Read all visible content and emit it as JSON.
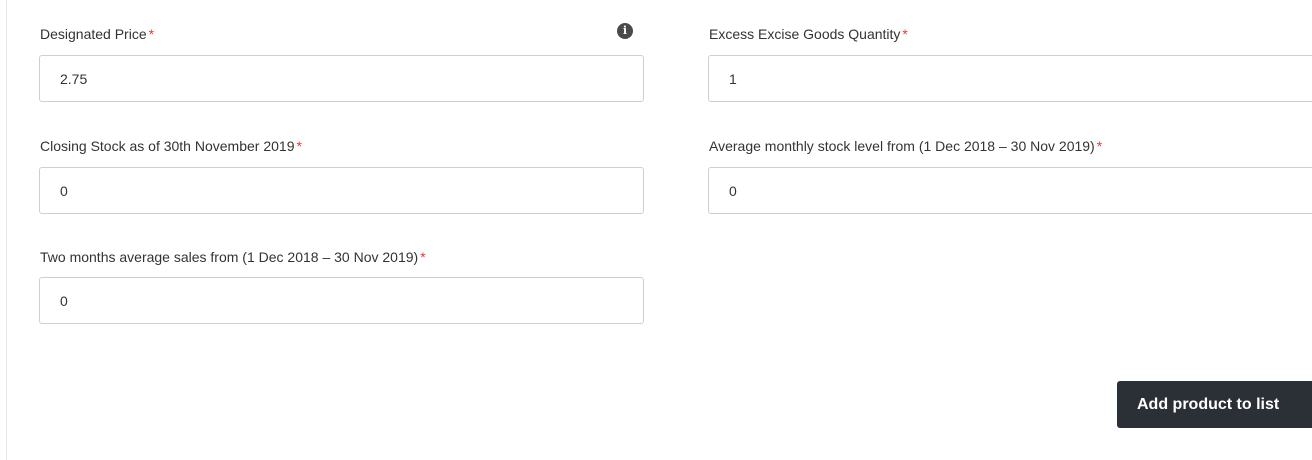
{
  "form": {
    "designated_price": {
      "label": "Designated Price",
      "required_mark": "*",
      "value": "2.75",
      "info_icon": "info-circle-icon"
    },
    "excess_excise_goods_quantity": {
      "label": "Excess Excise Goods Quantity",
      "required_mark": "*",
      "value": "1"
    },
    "closing_stock": {
      "label": "Closing Stock as of 30th November 2019",
      "required_mark": "*",
      "value": "0"
    },
    "average_monthly_stock_level": {
      "label": "Average monthly stock level from (1 Dec 2018 – 30 Nov 2019)",
      "required_mark": "*",
      "value": "0"
    },
    "two_months_average_sales": {
      "label": "Two months average sales from (1 Dec 2018 – 30 Nov 2019)",
      "required_mark": "*",
      "value": "0"
    }
  },
  "actions": {
    "add_product_label": "Add product to list"
  },
  "colors": {
    "required": "#e53935",
    "button_bg": "#2b2f36",
    "input_border": "#cfcfcf"
  }
}
